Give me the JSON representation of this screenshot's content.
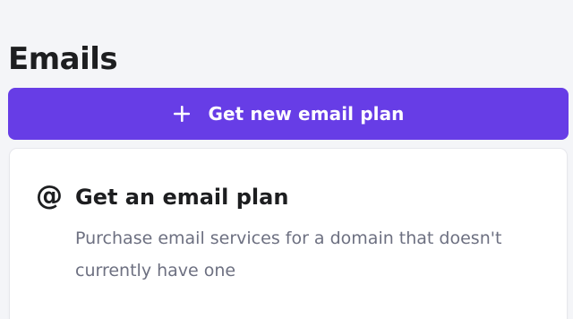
{
  "page": {
    "title": "Emails"
  },
  "actions": {
    "new_plan_button": {
      "icon": "plus-icon",
      "label": "Get new email plan"
    }
  },
  "email_plan_card": {
    "icon": "at-sign-icon",
    "icon_glyph": "@",
    "title": "Get an email plan",
    "description": "Purchase email services for a domain that doesn't currently have one"
  },
  "colors": {
    "accent": "#673de6",
    "background": "#f4f5f8",
    "card": "#ffffff",
    "text_primary": "#1d1e20",
    "text_secondary": "#6d7081"
  }
}
